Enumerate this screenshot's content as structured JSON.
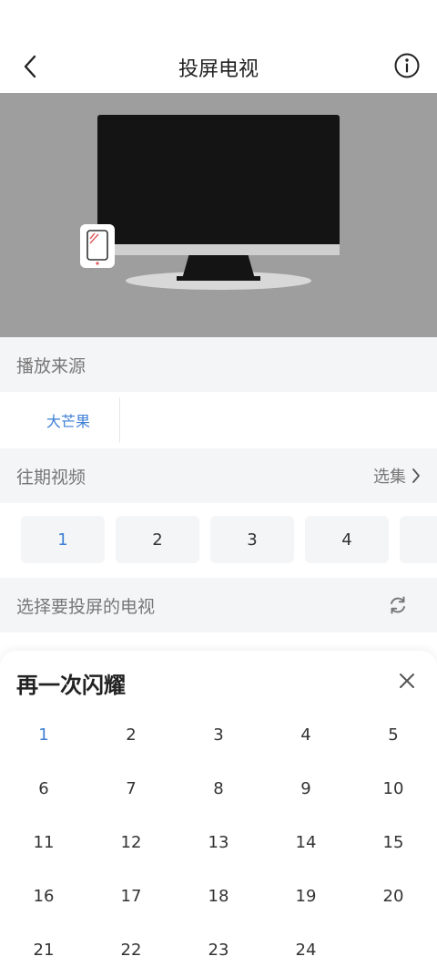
{
  "header": {
    "title": "投屏电视",
    "back_icon": "chevron-left-icon",
    "info_icon": "info-circle-icon"
  },
  "source_section": {
    "title": "播放来源",
    "tabs": [
      "大芒果"
    ]
  },
  "episodes_section": {
    "title": "往期视频",
    "more_label": "选集",
    "episodes": [
      "1",
      "2",
      "3",
      "4"
    ]
  },
  "device_section": {
    "title": "选择要投屏的电视",
    "refresh_icon": "refresh-icon"
  },
  "sheet": {
    "title": "再一次闪耀",
    "close_icon": "close-icon",
    "episodes": [
      "1",
      "2",
      "3",
      "4",
      "5",
      "6",
      "7",
      "8",
      "9",
      "10",
      "11",
      "12",
      "13",
      "14",
      "15",
      "16",
      "17",
      "18",
      "19",
      "20",
      "21",
      "22",
      "23",
      "24"
    ],
    "selected": "1"
  },
  "colors": {
    "accent": "#3d7fd6",
    "section_bg": "#f4f5f7",
    "preview_bg": "#9e9e9e"
  }
}
